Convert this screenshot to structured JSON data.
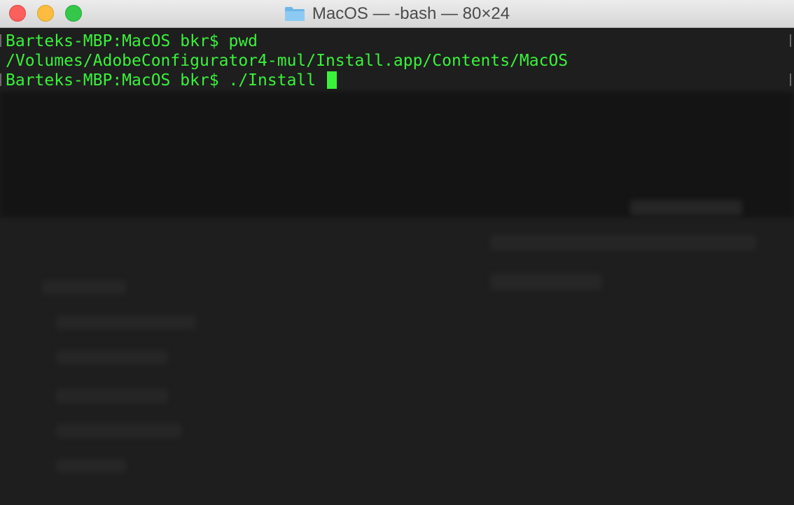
{
  "window": {
    "title": "MacOS — -bash — 80×24",
    "title_icon": "folder-icon"
  },
  "terminal": {
    "lines": [
      "Barteks-MBP:MacOS bkr$ pwd",
      "/Volumes/AdobeConfigurator4-mul/Install.app/Contents/MacOS",
      "Barteks-MBP:MacOS bkr$ ./Install "
    ],
    "text_color": "#39f23a",
    "background": "#1e1e1e"
  }
}
